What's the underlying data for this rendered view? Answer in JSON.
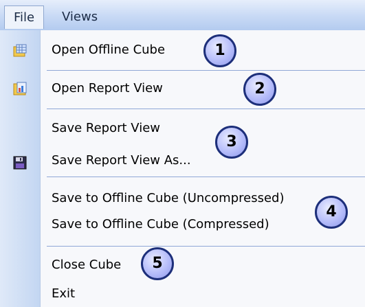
{
  "menubar": {
    "file": "File",
    "views": "Views"
  },
  "menu": {
    "open_offline_cube": "Open Offline Cube",
    "open_report_view": "Open Report View",
    "save_report_view": "Save Report View",
    "save_report_view_as": "Save Report View As...",
    "save_offline_uncompressed": "Save to Offline Cube (Uncompressed)",
    "save_offline_compressed": "Save to Offline Cube (Compressed)",
    "close_cube": "Close Cube",
    "exit": "Exit"
  },
  "callouts": [
    "1",
    "2",
    "3",
    "4",
    "5"
  ],
  "icons": {
    "open_offline_cube": "grid-cube-icon",
    "open_report_view": "report-chart-icon",
    "save_report_view_as": "floppy-disk-icon"
  },
  "colors": {
    "gutter": "#c3d6f2",
    "separator": "#8fa7d6",
    "badge_border": "#1d2f7a",
    "badge_fill": "#b6bdfa"
  }
}
